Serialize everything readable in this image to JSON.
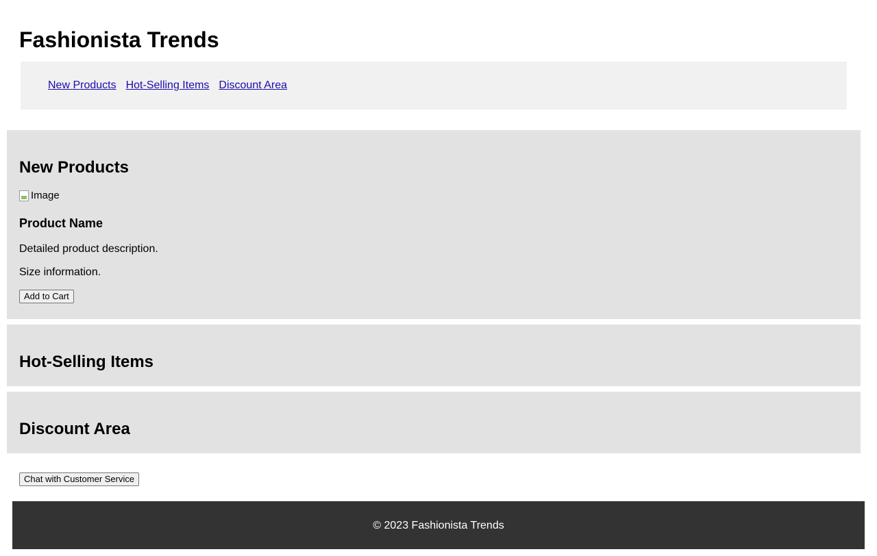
{
  "header": {
    "title": "Fashionista Trends",
    "nav": [
      {
        "label": "New Products"
      },
      {
        "label": "Hot-Selling Items"
      },
      {
        "label": "Discount Area"
      }
    ]
  },
  "sections": {
    "new_products": {
      "heading": "New Products",
      "product": {
        "image_alt": "Image",
        "name": "Product Name",
        "description": "Detailed product description.",
        "size": "Size information.",
        "add_to_cart_label": "Add to Cart"
      }
    },
    "hot_selling": {
      "heading": "Hot-Selling Items"
    },
    "discount": {
      "heading": "Discount Area"
    }
  },
  "chat": {
    "button_label": "Chat with Customer Service"
  },
  "footer": {
    "copyright": "© 2023 Fashionista Trends"
  },
  "colors": {
    "nav_background": "#f1f1f1",
    "section_background": "#e2e2e2",
    "footer_background": "#333333",
    "link": "#1a0dab"
  }
}
